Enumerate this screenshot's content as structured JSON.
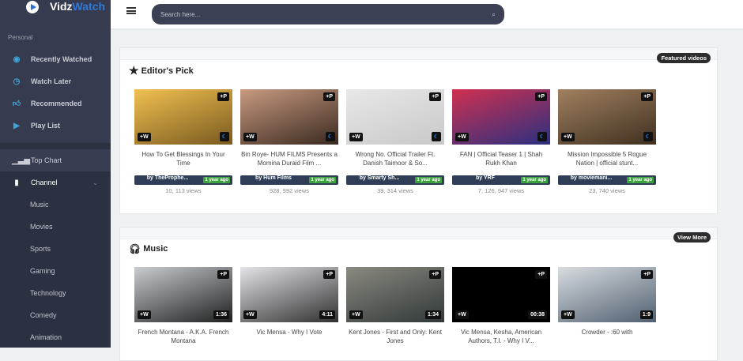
{
  "app": {
    "name_part1": "Vidz",
    "name_part2": "Watch"
  },
  "sidebar": {
    "section_label": "Personal",
    "personal": [
      {
        "label": "Recently Watched",
        "icon": "eye-icon"
      },
      {
        "label": "Watch Later",
        "icon": "clock-icon"
      },
      {
        "label": "Recommended",
        "icon": "thumbs-up-icon"
      },
      {
        "label": "Play List",
        "icon": "play-icon"
      }
    ],
    "top_chart": "Top Chart",
    "channel": "Channel",
    "channel_items": [
      "Music",
      "Movies",
      "Sports",
      "Gaming",
      "Technology",
      "Comedy",
      "Animation"
    ]
  },
  "header": {
    "search_placeholder": "Search here..."
  },
  "editors_pick": {
    "title": "Editor's Pick",
    "badge": "Featured videos",
    "videos": [
      {
        "title": "How To Get Blessings In Your Time",
        "by": "by TheProphe...",
        "age": "1 year ago",
        "views": "10, 113 views",
        "plus_p": "+P",
        "plus_w": "+W",
        "colors": [
          "#f0c050",
          "#7a5a20"
        ]
      },
      {
        "title": "Bin Roye- HUM FILMS Presents a Momina Duraid Film ...",
        "by": "by Hum Films",
        "age": "1 year ago",
        "views": "928, 992 views",
        "plus_p": "+P",
        "plus_w": "+W",
        "colors": [
          "#c89a80",
          "#3a2a20"
        ]
      },
      {
        "title": "Wrong No. Official Trailer Ft. Danish Taimoor & So...",
        "by": "by Smarty Sh...",
        "age": "1 year ago",
        "views": "39, 314 views",
        "plus_p": "+P",
        "plus_w": "+W",
        "colors": [
          "#e8e8e8",
          "#c8c8c8"
        ]
      },
      {
        "title": "FAN | Official Teaser 1 | Shah Rukh Khan",
        "by": "by YRF",
        "age": "1 year ago",
        "views": "7, 126, 947 views",
        "plus_p": "+P",
        "plus_w": "+W",
        "colors": [
          "#d03050",
          "#2a3080"
        ]
      },
      {
        "title": "Mission Impossible 5 Rogue Nation | official stunt...",
        "by": "by moviemani...",
        "age": "1 year ago",
        "views": "23, 740 views",
        "plus_p": "+P",
        "plus_w": "+W",
        "colors": [
          "#a08060",
          "#403020"
        ]
      }
    ]
  },
  "music": {
    "title": "Music",
    "badge": "View More",
    "videos": [
      {
        "title": "French Montana - A.K.A. French Montana",
        "duration": "1:36",
        "plus_p": "+P",
        "plus_w": "+W",
        "colors": [
          "#c8ccd0",
          "#202020"
        ]
      },
      {
        "title": "Vic Mensa - Why I Vote",
        "duration": "4:11",
        "plus_p": "+P",
        "plus_w": "+W",
        "colors": [
          "#e4e4e8",
          "#303030"
        ]
      },
      {
        "title": "Kent Jones - First and Only: Kent Jones",
        "duration": "1:34",
        "plus_p": "+P",
        "plus_w": "+W",
        "colors": [
          "#8a8a80",
          "#303838"
        ]
      },
      {
        "title": "Vic Mensa, Kesha, American Authors, T.I. - Why I V...",
        "duration": "00:38",
        "plus_p": "+P",
        "plus_w": "+W",
        "colors": [
          "#000000",
          "#000000"
        ]
      },
      {
        "title": "Crowder - :60 with",
        "duration": "1:9",
        "plus_p": "+P",
        "plus_w": "+W",
        "colors": [
          "#d8dce0",
          "#506070"
        ]
      }
    ]
  }
}
